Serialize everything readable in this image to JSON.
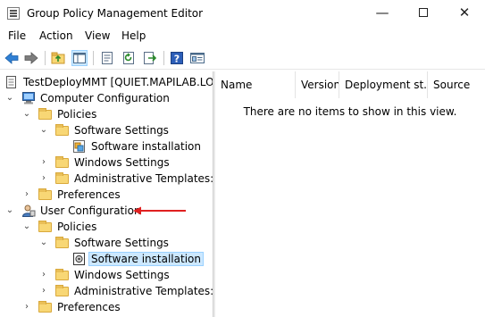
{
  "window": {
    "title": "Group Policy Management Editor",
    "controls": {
      "minimize": "—",
      "maximize": "",
      "close": "✕"
    }
  },
  "menu": [
    "File",
    "Action",
    "View",
    "Help"
  ],
  "toolbar": {
    "buttons": [
      "back-icon",
      "forward-icon",
      "up-folder-icon",
      "show-tree-icon",
      "properties-icon",
      "refresh-icon",
      "export-icon",
      "help-icon",
      "console-icon"
    ]
  },
  "tree": {
    "root": "TestDeployMMT [QUIET.MAPILAB.LOCAL]",
    "computer_config": "Computer Configuration",
    "cc_policies": "Policies",
    "cc_software_settings": "Software Settings",
    "cc_software_installation": "Software installation",
    "cc_windows_settings": "Windows Settings",
    "cc_admin_templates": "Administrative Templates: Policy",
    "cc_preferences": "Preferences",
    "user_config": "User Configuration",
    "uc_policies": "Policies",
    "uc_software_settings": "Software Settings",
    "uc_software_installation": "Software installation",
    "uc_windows_settings": "Windows Settings",
    "uc_admin_templates": "Administrative Templates: Policy",
    "uc_preferences": "Preferences"
  },
  "list": {
    "columns": [
      "Name",
      "Version",
      "Deployment st...",
      "Source"
    ],
    "empty_message": "There are no items to show in this view."
  },
  "colors": {
    "selection": "#cce8ff",
    "annotation_arrow": "#e02020",
    "folder": "#f8d775"
  }
}
